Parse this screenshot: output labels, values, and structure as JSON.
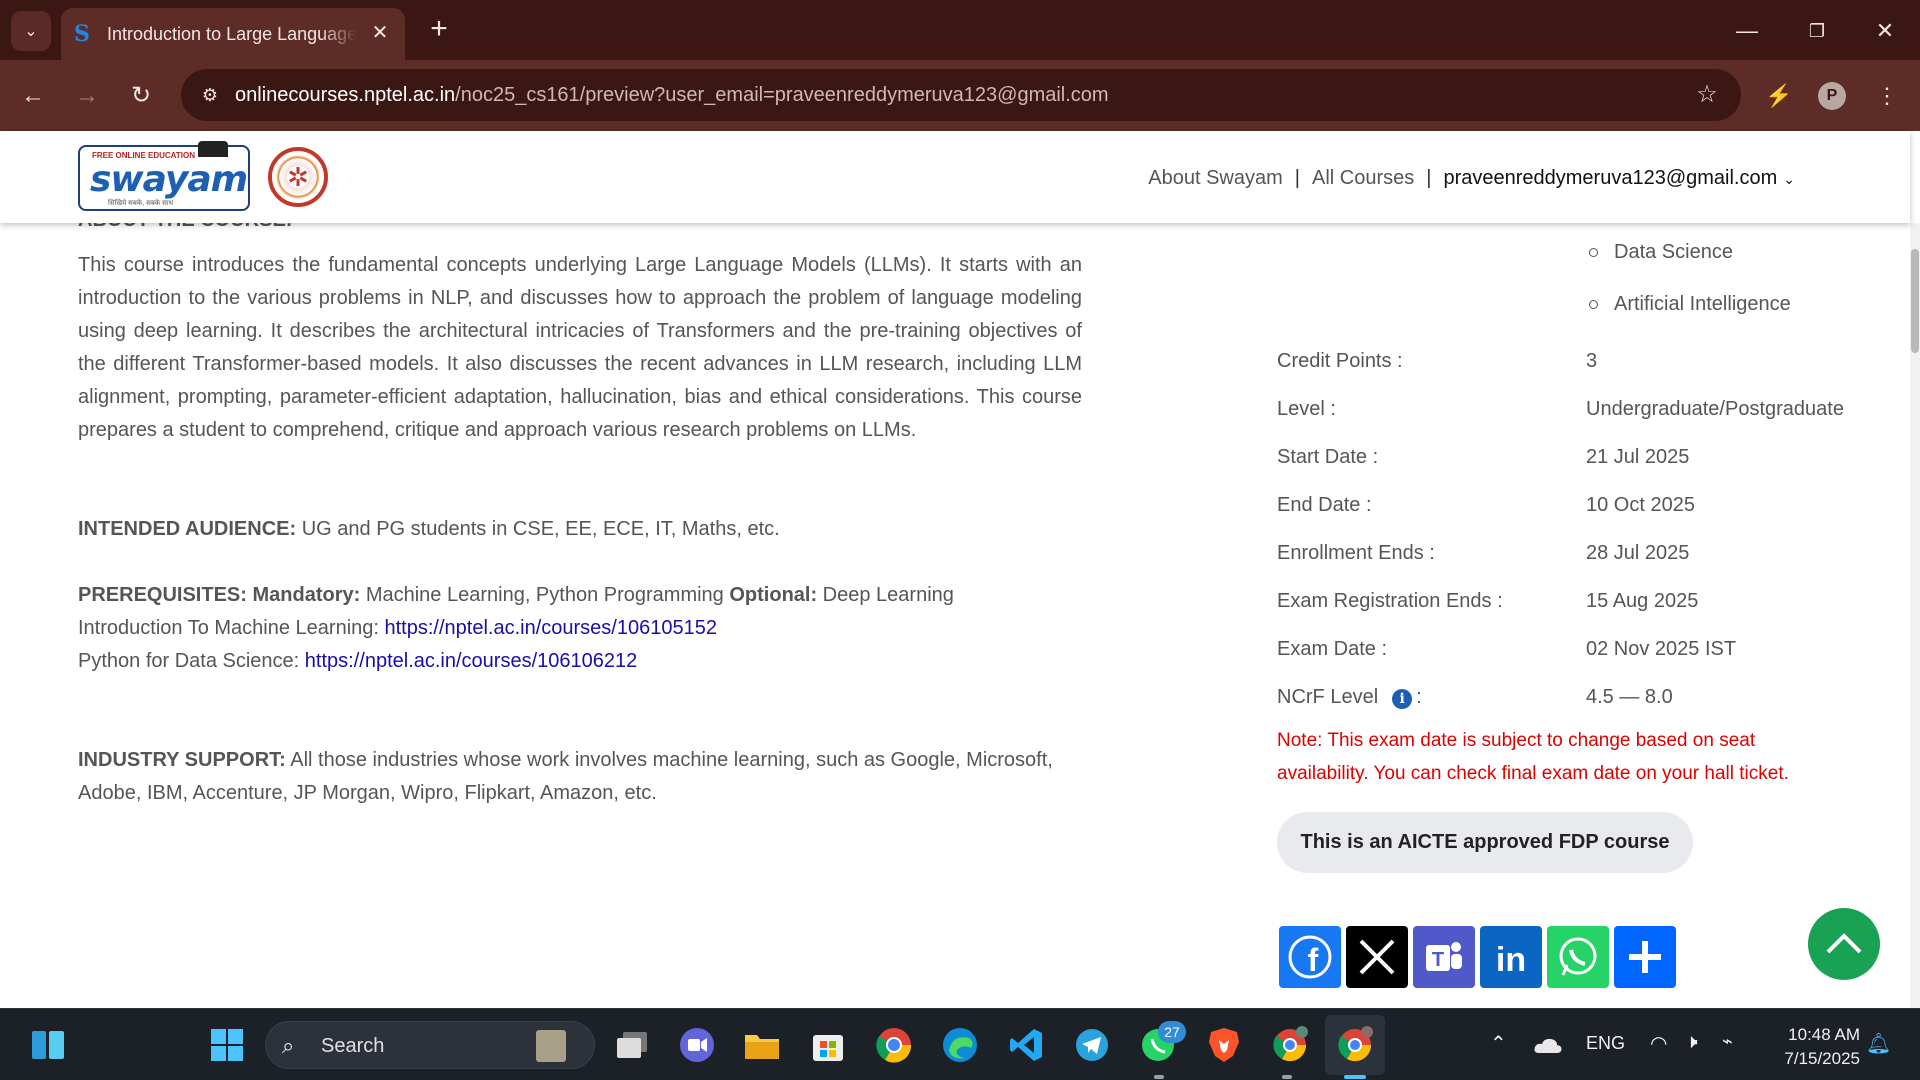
{
  "browser": {
    "tab_title": "Introduction to Large Language Models (LLMs) - Course",
    "tab_close": "✕",
    "new_tab": "+",
    "url_host": "onlinecourses.nptel.ac.in",
    "url_path": "/noc25_cs161/preview?user_email=praveenreddymeruva123@gmail.com",
    "profile_initial": "P",
    "accent_color": "#5d2c27"
  },
  "site": {
    "logo_tag": "FREE ONLINE EDUCATION",
    "logo_word": "swayam",
    "logo_sub": "सिखिये सबके, सबके साथ",
    "nav": {
      "about": "About Swayam",
      "sep": "|",
      "courses": "All Courses",
      "user_email": "praveenreddymeruva123@gmail.com"
    }
  },
  "course": {
    "about_heading": "ABOUT THE COURSE:",
    "about_text": "This course introduces the fundamental concepts underlying Large Language Models (LLMs). It starts with an introduction to the various problems in NLP, and discusses how to approach the problem of language modeling using deep learning. It describes the architectural intricacies of Transformers and the pre-training objectives of the different Transformer-based models. It also discusses the recent advances in LLM research, including LLM alignment, prompting, parameter-efficient adaptation, hallucination, bias and ethical considerations. This course prepares a student to comprehend, critique and approach various research problems on LLMs.",
    "audience_label": "INTENDED AUDIENCE:",
    "audience_text": " UG and PG students in CSE, EE, ECE, IT, Maths, etc.",
    "prereq_label": "PREREQUISITES:",
    "mandatory_label": " Mandatory:",
    "mandatory_text": " Machine Learning, Python Programming ",
    "optional_label": "Optional:",
    "optional_text": " Deep Learning",
    "ml_intro_label": "Introduction To Machine Learning: ",
    "ml_intro_link": "https://nptel.ac.in/courses/106105152",
    "pyds_label": "Python for Data Science: ",
    "pyds_link": "https://nptel.ac.in/courses/106106212",
    "industry_label": "INDUSTRY SUPPORT:",
    "industry_text": " All those industries whose work involves machine learning, such as Google, Microsoft, Adobe, IBM, Accenture, JP Morgan, Wipro, Flipkart, Amazon, etc."
  },
  "sidebar": {
    "topics": [
      "Data Science",
      "Artificial Intelligence"
    ],
    "rows": [
      {
        "key": "Credit Points :",
        "value": "3"
      },
      {
        "key": "Level :",
        "value": "Undergraduate/Postgraduate"
      },
      {
        "key": "Start Date :",
        "value": "21 Jul 2025"
      },
      {
        "key": "End Date :",
        "value": "10 Oct 2025"
      },
      {
        "key": "Enrollment Ends :",
        "value": "28 Jul 2025"
      },
      {
        "key": "Exam Registration Ends :",
        "value": "15 Aug 2025"
      },
      {
        "key": "Exam Date :",
        "value": "02 Nov 2025 IST"
      },
      {
        "key": "NCrF Level",
        "key_suffix": ":",
        "value": "4.5 — 8.0"
      }
    ],
    "note": "Note: This exam date is subject to change based on seat availability. You can check final exam date on your hall ticket.",
    "fdp_badge": "This is an AICTE approved FDP course",
    "share_buttons": [
      "facebook-icon",
      "x-icon",
      "teams-icon",
      "linkedin-icon",
      "whatsapp-icon",
      "share-plus-icon"
    ]
  },
  "taskbar": {
    "search_placeholder": "Search",
    "whatsapp_badge": "27",
    "language": "ENG",
    "time": "10:48 AM",
    "date": "7/15/2025"
  }
}
